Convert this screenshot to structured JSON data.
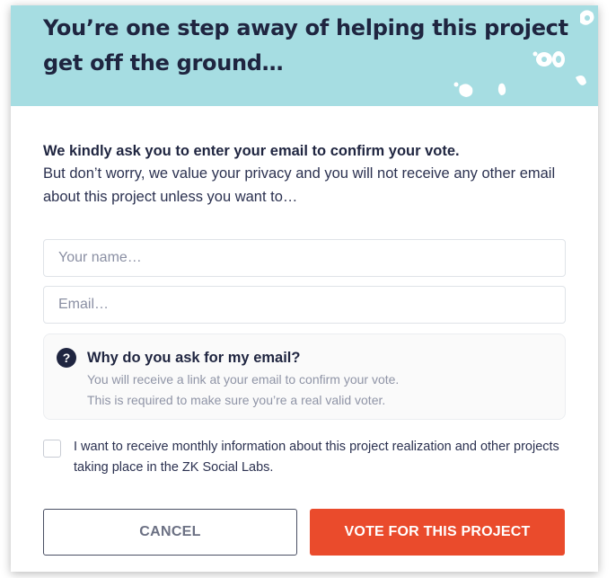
{
  "header": {
    "title": "You’re one step away of helping this project get off the ground…",
    "background_color": "#a6dde2"
  },
  "intro": {
    "bold_text": "We kindly ask you to enter your email to confirm your vote.",
    "text": "But don’t worry, we value your privacy and you will not receive any other email about this project unless you want to…"
  },
  "form": {
    "name_placeholder": "Your name…",
    "name_value": "",
    "email_placeholder": "Email…",
    "email_value": ""
  },
  "info": {
    "icon": "question-icon",
    "icon_glyph": "?",
    "title": "Why do you ask for my email?",
    "line1": "You will receive a link at your email to confirm your vote.",
    "line2": "This is required to make sure you’re a real valid voter."
  },
  "newsletter": {
    "checked": false,
    "label": "I want to receive monthly information about this project realization and other projects taking place in the ZK Social Labs."
  },
  "buttons": {
    "cancel_label": "CANCEL",
    "vote_label": "VOTE  FOR THIS PROJECT",
    "vote_color": "#ea4b2c"
  }
}
